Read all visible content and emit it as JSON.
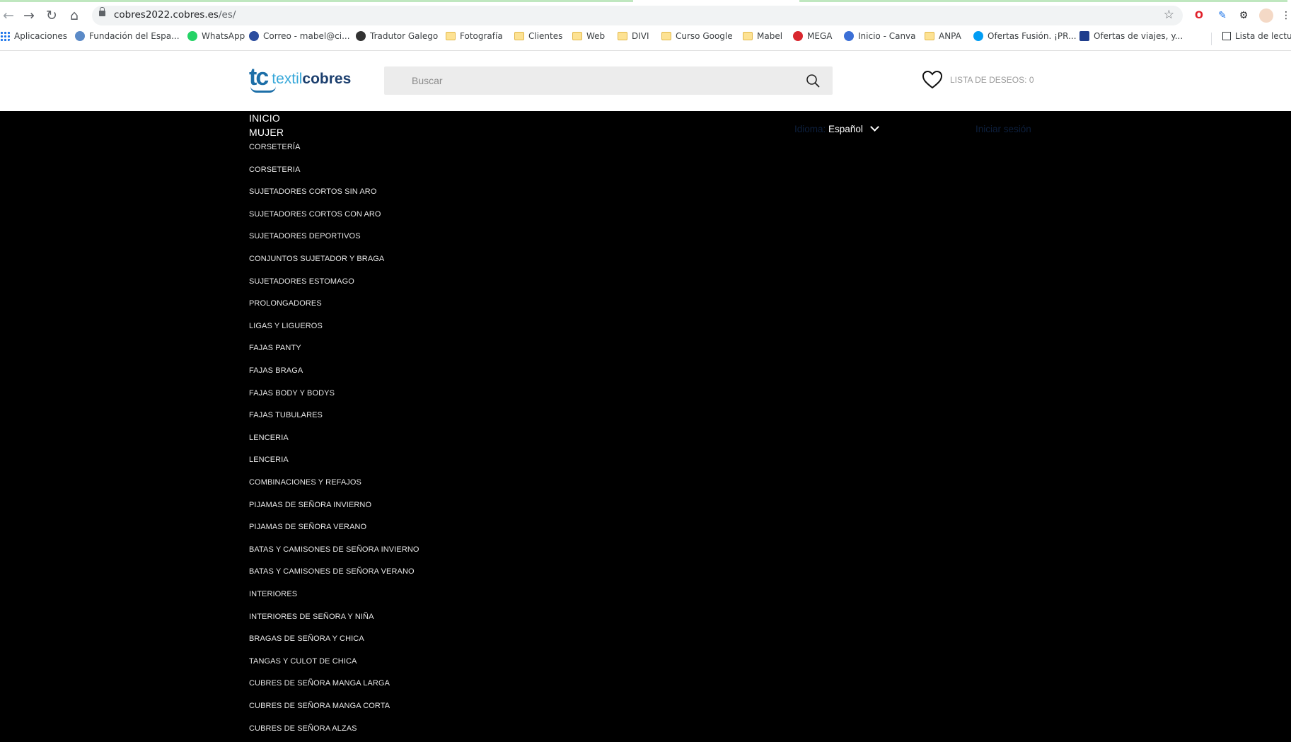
{
  "browser": {
    "url_host": "cobres2022.cobres.es",
    "url_path": "/es/",
    "bookmarks": [
      {
        "label": "Aplicaciones",
        "icon": "apps-grid-icon"
      },
      {
        "label": "Fundación del Espa...",
        "icon": "fundacion-favicon"
      },
      {
        "label": "WhatsApp",
        "icon": "whatsapp-icon"
      },
      {
        "label": "Correo - mabel@ci...",
        "icon": "mail-favicon"
      },
      {
        "label": "Tradutor Galego",
        "icon": "translator-favicon"
      },
      {
        "label": "Fotografía",
        "icon": "folder-icon"
      },
      {
        "label": "Clientes",
        "icon": "folder-icon"
      },
      {
        "label": "Web",
        "icon": "folder-icon"
      },
      {
        "label": "DIVI",
        "icon": "folder-icon"
      },
      {
        "label": "Curso Google",
        "icon": "folder-icon"
      },
      {
        "label": "Mabel",
        "icon": "folder-icon"
      },
      {
        "label": "MEGA",
        "icon": "mega-icon"
      },
      {
        "label": "Inicio - Canva",
        "icon": "canva-icon"
      },
      {
        "label": "ANPA",
        "icon": "folder-icon"
      },
      {
        "label": "Ofertas Fusión. ¡PR...",
        "icon": "movistar-icon"
      },
      {
        "label": "Ofertas de viajes, y...",
        "icon": "travel-favicon"
      }
    ],
    "reading_list": "Lista de lectur"
  },
  "header": {
    "logo_tc": "tc",
    "logo_textil": "textil",
    "logo_cobres": "cobres",
    "search_placeholder": "Buscar",
    "wishlist_label": "LISTA DE DESEOS: 0"
  },
  "nav": {
    "inicio": "INICIO",
    "mujer": "MUJER",
    "language_label": "Idioma:",
    "language_value": "Español",
    "login": "Iniciar sesión",
    "items": [
      "CORSETERÍA",
      "CORSETERIA",
      "SUJETADORES CORTOS SIN ARO",
      "SUJETADORES CORTOS CON ARO",
      "SUJETADORES DEPORTIVOS",
      "CONJUNTOS SUJETADOR Y BRAGA",
      "SUJETADORES ESTOMAGO",
      "PROLONGADORES",
      "LIGAS Y LIGUEROS",
      "FAJAS PANTY",
      "FAJAS BRAGA",
      "FAJAS BODY Y BODYS",
      "FAJAS TUBULARES",
      "LENCERIA",
      "LENCERIA",
      "COMBINACIONES Y REFAJOS",
      "PIJAMAS DE SEÑORA INVIERNO",
      "PIJAMAS DE SEÑORA VERANO",
      "BATAS Y CAMISONES DE SEÑORA INVIERNO",
      "BATAS Y CAMISONES DE SEÑORA VERANO",
      "INTERIORES",
      "INTERIORES DE SEÑORA Y NIÑA",
      "BRAGAS DE SEÑORA Y CHICA",
      "TANGAS Y CULOT DE CHICA",
      "CUBRES DE SEÑORA MANGA LARGA",
      "CUBRES DE SEÑORA MANGA CORTA",
      "CUBRES DE SEÑORA ALZAS"
    ]
  }
}
